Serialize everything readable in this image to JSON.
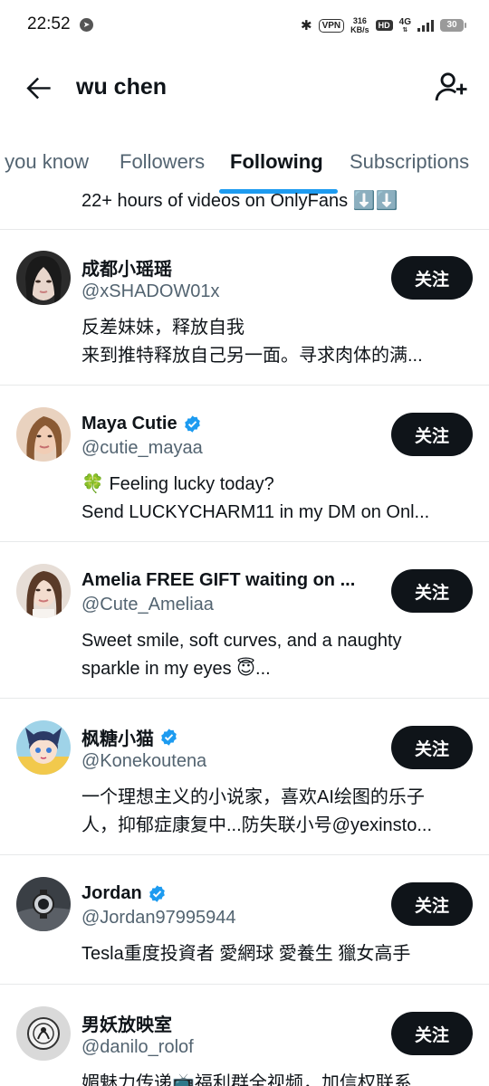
{
  "status_bar": {
    "time": "22:52",
    "vpn": "VPN",
    "speed_value": "316",
    "speed_unit": "KB/s",
    "hd": "HD",
    "network": "4G",
    "battery": "30"
  },
  "header": {
    "title": "wu chen",
    "back_icon": "arrow-left-icon",
    "add_icon": "person-add-icon"
  },
  "tabs": [
    {
      "label": "s you know"
    },
    {
      "label": "Followers"
    },
    {
      "label": "Following"
    },
    {
      "label": "Subscriptions"
    }
  ],
  "active_tab": "Following",
  "partial_row": {
    "text": "22+ hours of videos on OnlyFans ⬇️⬇️"
  },
  "users": [
    {
      "name": "成都小瑶瑶",
      "handle": "@xSHADOW01x",
      "verified": false,
      "bio": [
        "反差妹妹，释放自我",
        "来到推特释放自己另一面。寻求肉体的满..."
      ],
      "button": "关注"
    },
    {
      "name": "Maya Cutie",
      "handle": "@cutie_mayaa",
      "verified": true,
      "bio": [
        "🍀 Feeling lucky today?",
        "Send LUCKYCHARM11 in my DM on Onl..."
      ],
      "button": "关注"
    },
    {
      "name": "Amelia FREE GIFT waiting on ...",
      "handle": "@Cute_Ameliaa",
      "verified": false,
      "bio": [
        "Sweet smile, soft curves, and a naughty",
        "sparkle in my eyes 😇..."
      ],
      "button": "关注"
    },
    {
      "name": "枫糖小猫",
      "handle": "@Konekoutena",
      "verified": true,
      "bio": [
        "一个理想主义的小说家，喜欢AI绘图的乐子",
        "人，抑郁症康复中...防失联小号@yexinsto..."
      ],
      "button": "关注"
    },
    {
      "name": "Jordan",
      "handle": "@Jordan97995944",
      "verified": true,
      "bio": [
        "Tesla重度投資者 愛網球 愛養生 獵女高手"
      ],
      "button": "关注"
    },
    {
      "name": "男妖放映室",
      "handle": "@danilo_rolof",
      "verified": false,
      "bio": [
        "媚魅力传递📺福利群全视频，加信权联系"
      ],
      "button": "关注"
    }
  ],
  "colors": {
    "accent": "#1d9bf0",
    "text": "#0f1419",
    "secondary": "#536471",
    "button_bg": "#0f1419",
    "divider": "#e7e9ea"
  }
}
